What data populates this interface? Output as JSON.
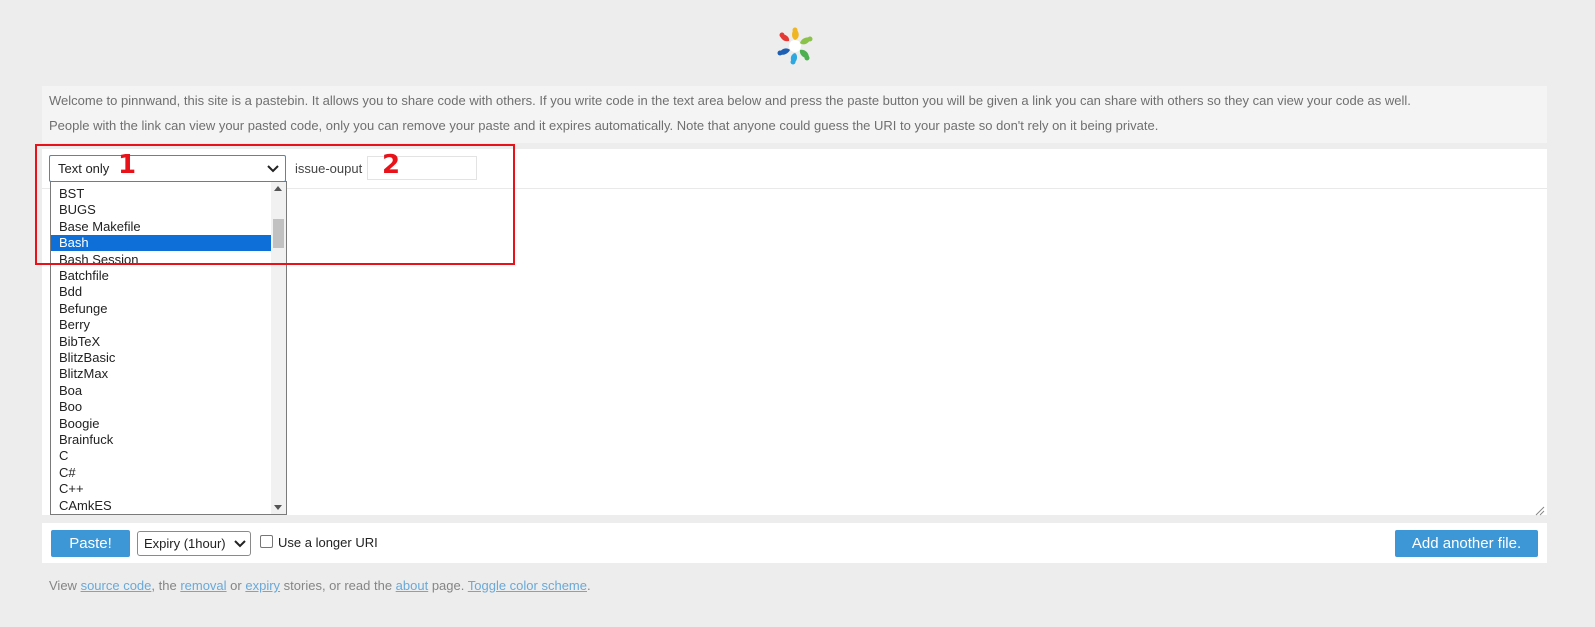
{
  "intro": {
    "line1": "Welcome to pinnwand, this site is a pastebin. It allows you to share code with others. If you write code in the text area below and press the paste button you will be given a link you can share with others so they can view your code as well.",
    "line2": "People with the link can view your pasted code, only you can remove your paste and it expires automatically. Note that anyone could guess the URI to your paste so don't rely on it being private."
  },
  "editor": {
    "language_selected": "Text only",
    "filename_label": "issue-ouput",
    "filename_value": ""
  },
  "dropdown": {
    "options": [
      "BST",
      "BUGS",
      "Base Makefile",
      "Bash",
      "Bash Session",
      "Batchfile",
      "Bdd",
      "Befunge",
      "Berry",
      "BibTeX",
      "BlitzBasic",
      "BlitzMax",
      "Boa",
      "Boo",
      "Boogie",
      "Brainfuck",
      "C",
      "C#",
      "C++",
      "CAmkES"
    ],
    "highlighted": "Bash"
  },
  "annotations": {
    "marker1": "1",
    "marker2": "2"
  },
  "actions": {
    "paste_label": "Paste!",
    "expiry_selected": "Expiry (1hour)",
    "longer_uri_label": "Use a longer URI",
    "longer_uri_checked": false,
    "add_file_label": "Add another file."
  },
  "footer": {
    "t1": "View ",
    "link_source": "source code",
    "t2": ", the ",
    "link_removal": "removal",
    "t3": " or ",
    "link_expiry": "expiry",
    "t4": " stories, or read the ",
    "link_about": "about",
    "t5": " page. ",
    "link_toggle": "Toggle color scheme",
    "t6": "."
  },
  "colors": {
    "accent": "#3d97d6",
    "selection": "#0e6fd9",
    "annotation": "#e8121a",
    "link": "#6aa9d8"
  }
}
